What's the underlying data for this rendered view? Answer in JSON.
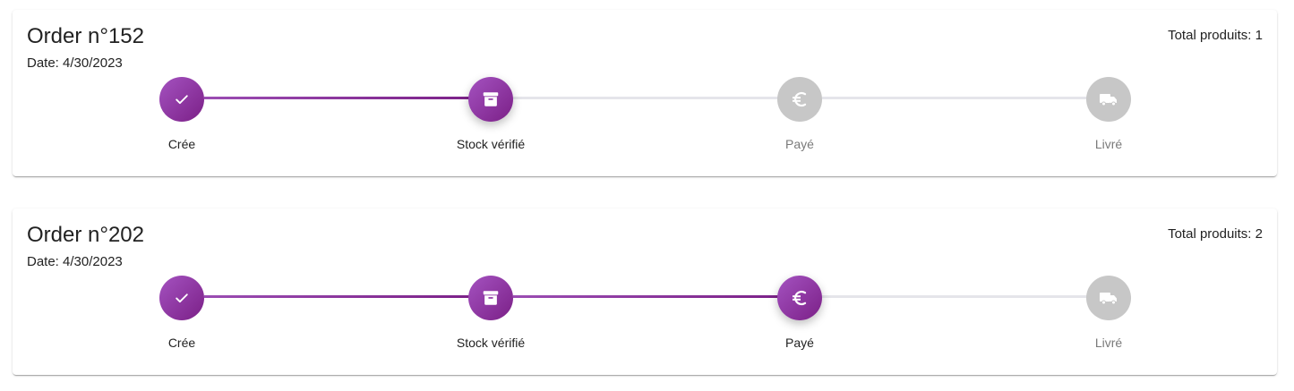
{
  "orders": [
    {
      "title": "Order n°152",
      "date": "Date: 4/30/2023",
      "total": "Total produits: 1",
      "steps": [
        {
          "label": "Crée",
          "icon": "check-icon",
          "state": "done"
        },
        {
          "label": "Stock vérifié",
          "icon": "archive-box-icon",
          "state": "current"
        },
        {
          "label": "Payé",
          "icon": "euro-icon",
          "state": "pending"
        },
        {
          "label": "Livré",
          "icon": "truck-icon",
          "state": "pending"
        }
      ]
    },
    {
      "title": "Order n°202",
      "date": "Date: 4/30/2023",
      "total": "Total produits: 2",
      "steps": [
        {
          "label": "Crée",
          "icon": "check-icon",
          "state": "done"
        },
        {
          "label": "Stock vérifié",
          "icon": "archive-box-icon",
          "state": "done"
        },
        {
          "label": "Payé",
          "icon": "euro-icon",
          "state": "current"
        },
        {
          "label": "Livré",
          "icon": "truck-icon",
          "state": "pending"
        }
      ]
    }
  ],
  "colors": {
    "accent": "#9c27b0",
    "accent_dark": "#7b2087",
    "inactive_step": "#c7c7c7",
    "inactive_connector": "#e5e5ea"
  }
}
